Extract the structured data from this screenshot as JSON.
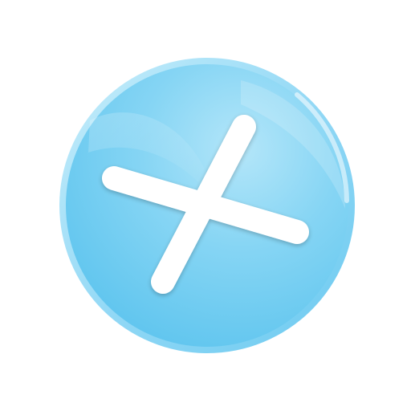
{
  "icon": {
    "name": "close-icon",
    "shape": "circle-with-x"
  },
  "colors": {
    "background": "#ffffff",
    "button_fill_light": "#a9e2f8",
    "button_fill_mid": "#7dd3f4",
    "button_fill_dark": "#5cc4ee",
    "button_rim": "#9adbf6",
    "glyph": "#ffffff"
  }
}
